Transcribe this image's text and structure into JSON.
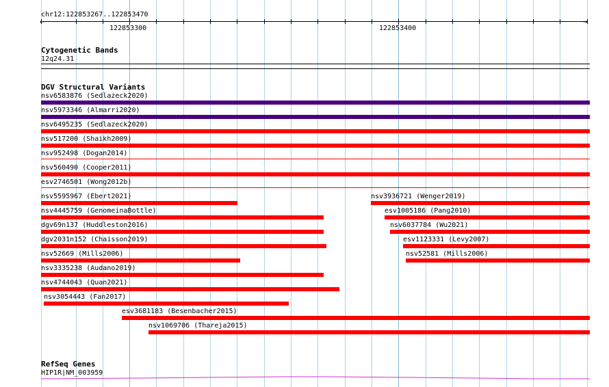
{
  "ruler": {
    "location": "chr12:122853267..122853470",
    "tick_labels": [
      "122853300",
      "122853400"
    ],
    "arrow_left": "←",
    "arrow_right": "→"
  },
  "colors": {
    "grid": "#a9d6e5",
    "variant_red": "#ff0000",
    "variant_purple": "#4b0082",
    "gene_line": "#cc33cc"
  },
  "cytoband_track": {
    "title": "Cytogenetic Bands",
    "band": "12q24.31"
  },
  "dgv_track": {
    "title": "DGV Structural Variants",
    "features": [
      {
        "label": "nsv6583876 (Sedlazeck2020)",
        "color": "#4b0082"
      },
      {
        "label": "nsv5973346 (Almarri2020)",
        "color": "#4b0082"
      },
      {
        "label": "nsv6495235 (Sedlazeck2020)",
        "color": "#ff0000"
      },
      {
        "label": "nsv517200 (Shaikh2009)",
        "color": "#ff0000"
      },
      {
        "label": "nsv952498 (Dogan2014)",
        "color": "#ff0000"
      },
      {
        "label": "nsv560490 (Cooper2011)",
        "color": "#ff0000"
      },
      {
        "label": "esv2746501 (Wong2012b)",
        "color": "#ff0000"
      },
      {
        "label": "nsv5595967 (Ebert2021)",
        "color": "#ff0000"
      },
      {
        "label": "nsv3936721 (Wenger2019)",
        "color": "#ff0000"
      },
      {
        "label": "nsv4445759 (GenomeinaBottle)",
        "color": "#ff0000"
      },
      {
        "label": "esv1005186 (Pang2010)",
        "color": "#ff0000"
      },
      {
        "label": "dgv69n137 (Huddleston2016)",
        "color": "#ff0000"
      },
      {
        "label": "nsv6037784 (Wu2021)",
        "color": "#ff0000"
      },
      {
        "label": "dgv2031n152 (Chaisson2019)",
        "color": "#ff0000"
      },
      {
        "label": "esv1123331 (Levy2007)",
        "color": "#ff0000"
      },
      {
        "label": "nsv52669 (Mills2006)",
        "color": "#ff0000"
      },
      {
        "label": "nsv52581 (Mills2006)",
        "color": "#ff0000"
      },
      {
        "label": "nsv3335238 (Audano2019)",
        "color": "#ff0000"
      },
      {
        "label": "nsv4744043 (Quan2021)",
        "color": "#ff0000"
      },
      {
        "label": "nsv3054443 (Fan2017)",
        "color": "#ff0000"
      },
      {
        "label": "esv3681183 (Besenbacher2015)",
        "color": "#ff0000"
      },
      {
        "label": "nsv1069706 (Thareja2015)",
        "color": "#ff0000"
      }
    ]
  },
  "refseq_track": {
    "title": "RefSeq Genes",
    "gene": "HIP1R|NM_003959"
  }
}
